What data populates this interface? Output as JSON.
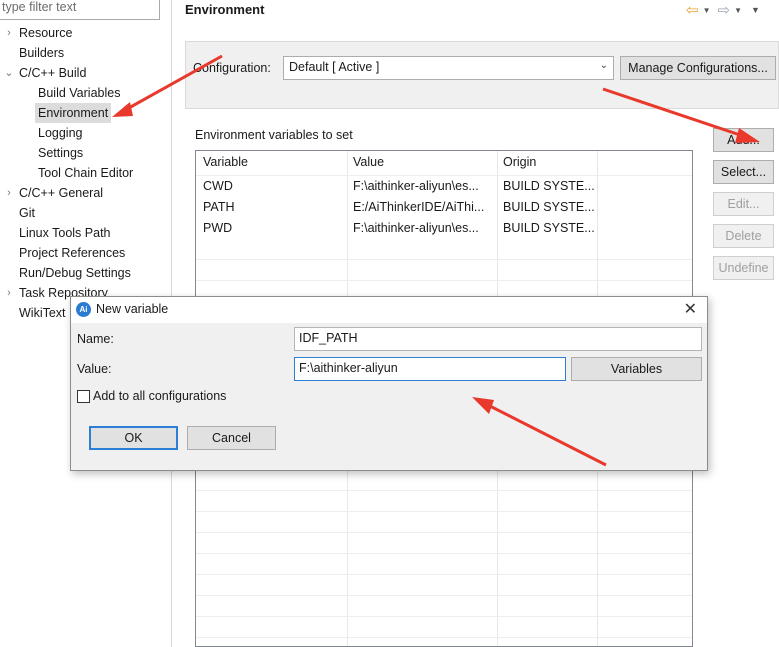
{
  "sidebar": {
    "filter_placeholder": "type filter text",
    "items": [
      {
        "label": "Resource",
        "expander": "›"
      },
      {
        "label": "Builders",
        "expander": ""
      },
      {
        "label": "C/C++ Build",
        "expander": "⌄"
      },
      {
        "label": "Build Variables"
      },
      {
        "label": "Environment"
      },
      {
        "label": "Logging"
      },
      {
        "label": "Settings"
      },
      {
        "label": "Tool Chain Editor"
      },
      {
        "label": "C/C++ General",
        "expander": "›"
      },
      {
        "label": "Git",
        "expander": ""
      },
      {
        "label": "Linux Tools Path",
        "expander": ""
      },
      {
        "label": "Project References",
        "expander": ""
      },
      {
        "label": "Run/Debug Settings",
        "expander": ""
      },
      {
        "label": "Task Repository",
        "expander": "›"
      },
      {
        "label": "WikiText",
        "expander": ""
      }
    ]
  },
  "page": {
    "title": "Environment",
    "configuration_label": "Configuration:",
    "configuration_value": "Default  [ Active ]",
    "manage_button": "Manage Configurations...",
    "env_label": "Environment variables to set"
  },
  "buttons": {
    "add": "Add...",
    "select": "Select...",
    "edit": "Edit...",
    "delete": "Delete",
    "undefine": "Undefine"
  },
  "table": {
    "headers": [
      "Variable",
      "Value",
      "Origin"
    ],
    "rows": [
      [
        "CWD",
        "F:\\aithinker-aliyun\\es...",
        "BUILD SYSTE..."
      ],
      [
        "PATH",
        "E:/AiThinkerIDE/AiThi...",
        "BUILD SYSTE..."
      ],
      [
        "PWD",
        "F:\\aithinker-aliyun\\es...",
        "BUILD SYSTE..."
      ]
    ]
  },
  "dialog": {
    "title": "New variable",
    "icon_text": "Ai",
    "name_label": "Name:",
    "name_value": "IDF_PATH",
    "value_label": "Value:",
    "value_value": "F:\\aithinker-aliyun",
    "variables_button": "Variables",
    "add_all_label": "Add to all configurations",
    "ok": "OK",
    "cancel": "Cancel"
  },
  "colors": {
    "annotation_arrow": "#e8392c",
    "focus": "#2d7fd6"
  }
}
